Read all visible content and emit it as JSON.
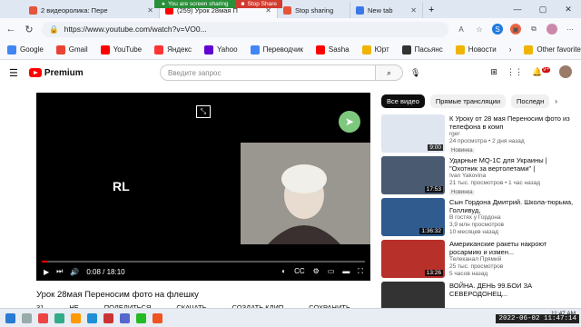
{
  "browser": {
    "tabs": [
      {
        "label": "2 видеоролика: Пере",
        "color": "#e6543b"
      },
      {
        "label": "(259) Урок 28мая П",
        "color": "#ff0000"
      },
      {
        "label": "Stop sharing",
        "color": "#e6543b"
      },
      {
        "label": "New tab",
        "color": "#3b78e7"
      }
    ],
    "share_msg": "You are screen sharing",
    "stop_label": "Stop Share",
    "url": "https://www.youtube.com/watch?v=VO0..."
  },
  "bookmarks": [
    {
      "label": "Google",
      "color": "#4285f4"
    },
    {
      "label": "Gmail",
      "color": "#ea4335"
    },
    {
      "label": "YouTube",
      "color": "#ff0000"
    },
    {
      "label": "Яндекс",
      "color": "#ff3333"
    },
    {
      "label": "Yahoo",
      "color": "#6001d2"
    },
    {
      "label": "Переводчик",
      "color": "#4285f4"
    },
    {
      "label": "Sasha",
      "color": "#ff0000"
    },
    {
      "label": "Юрт",
      "color": "#f0b400"
    },
    {
      "label": "Пасьянс",
      "color": "#333"
    },
    {
      "label": "Новости",
      "color": "#f0b400"
    },
    {
      "label": "Other favorites",
      "color": "#f0b400"
    }
  ],
  "youtube": {
    "logo": "Premium",
    "search_placeholder": "Введите запрос",
    "notif_count": "9+"
  },
  "video": {
    "overlay_text": "RL",
    "time": "0:08 / 18:10",
    "progress": 0.02,
    "title": "Урок 28мая Переносим фото на флешку",
    "actions": [
      "31",
      "НЕ",
      "ПОДЕЛИТЬСЯ",
      "СКАЧАТЬ",
      "СОЗДАТЬ КЛИП",
      "СОХРАНИТЬ"
    ]
  },
  "chips": [
    "Все видео",
    "Прямые трансляции",
    "Последн"
  ],
  "recommendations": [
    {
      "title": "К Уроку от 28 мая Переносим фото из телефона в комп",
      "channel": "rger",
      "stats": "24 просмотра • 2 дня назад",
      "badge": "Новинка",
      "duration": "9:00",
      "color": "#dfe6f0"
    },
    {
      "title": "Ударные MQ-1C для Украины | \"Охотник за вертолетами\" |",
      "channel": "Ivan Yakovina",
      "stats": "21 тыс. просмотров • 1 час назад",
      "badge": "Новинка",
      "duration": "17:53",
      "color": "#4a5a70"
    },
    {
      "title": "Сын Гордона Дмитрий. Школа-тюрьма, Голливуд,",
      "channel": "В гостях у Гордона",
      "stats": "3,9 млн просмотров",
      "badge": "10 месяцев назад",
      "duration": "1:36:32",
      "color": "#2f5b8f"
    },
    {
      "title": "Американские ракеты накроют росармию и измен...",
      "channel": "Телеканал Прямий",
      "stats": "25 тыс. просмотров",
      "badge": "5 часов назад",
      "duration": "13:26",
      "color": "#b8302a"
    },
    {
      "title": "ВОЙНА. ДЕНЬ 99.БОИ ЗА СЕВЕРОДОНЕЦ...",
      "channel": "",
      "stats": "",
      "badge": "",
      "duration": "",
      "color": "#333"
    }
  ],
  "taskbar": {
    "time": "11:47 AM",
    "date": "2022-06-02"
  },
  "stamp": "2022-06-02 11:47:14"
}
